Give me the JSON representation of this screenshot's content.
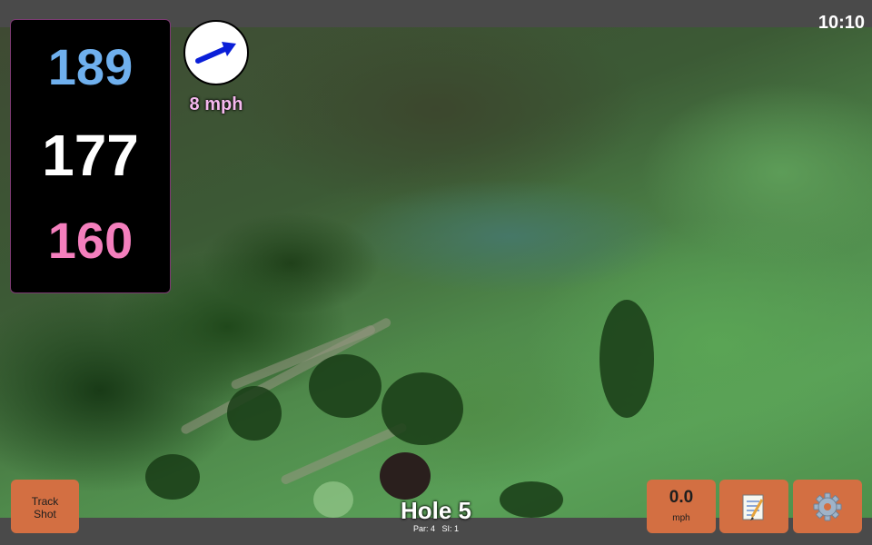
{
  "status": {
    "time": "10:10"
  },
  "distances": {
    "back": "189",
    "middle": "177",
    "front": "160"
  },
  "wind": {
    "speed_label": "8 mph",
    "direction_icon": "wind-arrow-icon"
  },
  "hole": {
    "title": "Hole 5",
    "par_label": "Par: 4",
    "si_label": "SI: 1"
  },
  "buttons": {
    "track_shot_line1": "Track",
    "track_shot_line2": "Shot",
    "speed_value": "0.0",
    "speed_unit": "mph",
    "notes_icon": "notepad-icon",
    "settings_icon": "gear-icon"
  },
  "colors": {
    "back_distance": "#6fb0ee",
    "middle_distance": "#ffffff",
    "front_distance": "#f47fbd",
    "button": "#d36f42",
    "wind_label": "#f5b8ee"
  }
}
